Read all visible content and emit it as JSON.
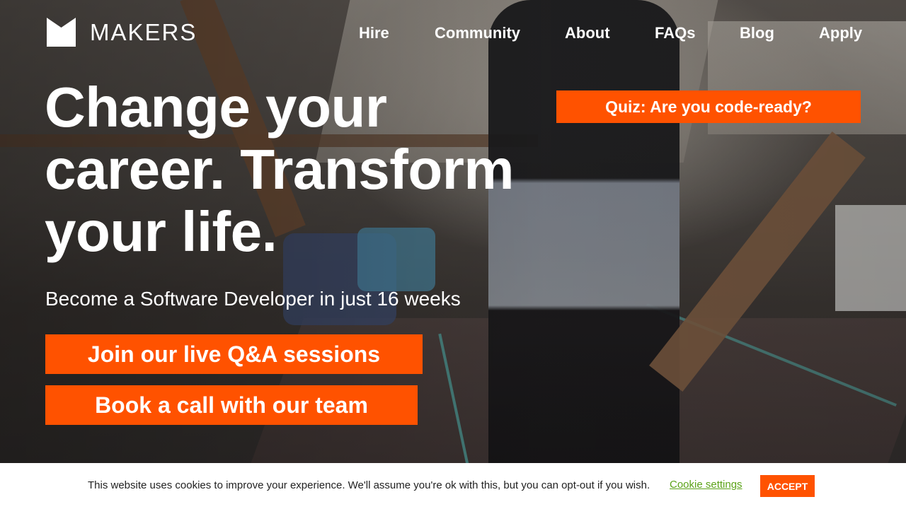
{
  "brand": {
    "name": "MAKERS",
    "icon": "makers-m-logo-icon"
  },
  "nav": {
    "items": [
      {
        "label": "Hire"
      },
      {
        "label": "Community"
      },
      {
        "label": "About"
      },
      {
        "label": "FAQs"
      },
      {
        "label": "Blog"
      },
      {
        "label": "Apply"
      }
    ]
  },
  "hero": {
    "headline_lines": [
      "Change your",
      "career. Transform",
      "your life."
    ],
    "subtitle": "Become a Software Developer in just 16 weeks",
    "primary_cta": "Join our live Q&A sessions",
    "secondary_cta": "Book a call with our team",
    "quiz_cta": "Quiz: Are you code-ready?"
  },
  "cookie_banner": {
    "message": "This website uses cookies to improve your experience. We'll assume you're ok with this, but you can opt-out if you wish.",
    "settings_label": "Cookie settings",
    "accept_label": "ACCEPT"
  },
  "colors": {
    "accent": "#ff5200",
    "cookie_link": "#5ca319",
    "text_light": "#ffffff"
  }
}
